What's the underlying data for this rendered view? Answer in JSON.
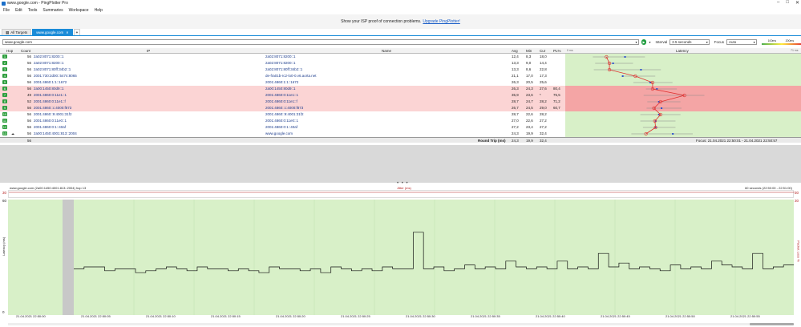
{
  "window": {
    "title": "www.google.com - PingPlotter Pro"
  },
  "menu": [
    "File",
    "Edit",
    "Tools",
    "Summaries",
    "Workspace",
    "Help"
  ],
  "promo": {
    "text": "Show your ISP proof of connection problems.",
    "link": "Upgrade PingPlotter!"
  },
  "tabs": [
    {
      "label": "All Targets"
    },
    {
      "label": "www.google.com"
    },
    {
      "label": "+"
    }
  ],
  "toolbar": {
    "target": "www.google.com",
    "interval_label": "Interval",
    "interval_value": "2.5 seconds",
    "focus_label": "Focus",
    "focus_value": "Auto",
    "legend_low": "100ms",
    "legend_high": "200ms"
  },
  "columns": {
    "hop": "Hop",
    "count": "Count",
    "ip": "IP",
    "name": "Name",
    "avg": "Avg",
    "min": "Min",
    "cur": "Cur",
    "pl": "PL%",
    "lat_zero": "0 ms",
    "latency": "Latency",
    "lat_max": "71 ms"
  },
  "hops": [
    {
      "hop": "1",
      "count": "56",
      "ip": "2a02:8071:8200::1",
      "name": "2a02:8071:8200::1",
      "avg": "12,4",
      "min": "8,3",
      "cur": "18,0",
      "pl": "",
      "loss": false
    },
    {
      "hop": "2",
      "count": "56",
      "ip": "2a02:8071:8200::1",
      "name": "2a02:8071:8200::1",
      "avg": "13,3",
      "min": "9,0",
      "cur": "14,4",
      "pl": "",
      "loss": false
    },
    {
      "hop": "3",
      "count": "56",
      "ip": "2a02:8071:80ff:34b2::1",
      "name": "2a02:8071:80ff:34b2::1",
      "avg": "13,3",
      "min": "8,6",
      "cur": "22,8",
      "pl": "",
      "loss": false
    },
    {
      "hop": "4",
      "count": "56",
      "ip": "2001:730:2d00::5474:8065",
      "name": "de-fra01b-rc2-lo0-0.v6.aorta.net",
      "avg": "21,1",
      "min": "17,0",
      "cur": "17,3",
      "pl": "",
      "loss": false
    },
    {
      "hop": "5",
      "count": "56",
      "ip": "2001:4860:1:1::1672",
      "name": "2001:4860:1:1::1672",
      "avg": "26,3",
      "min": "20,5",
      "cur": "25,6",
      "pl": "",
      "loss": false
    },
    {
      "hop": "6",
      "count": "56",
      "ip": "2a00:1450:80d9::1",
      "name": "2a00:1450:80d9::1",
      "avg": "26,3",
      "min": "24,3",
      "cur": "27,6",
      "pl": "80,4",
      "loss": true
    },
    {
      "hop": "7",
      "count": "49",
      "ip": "2001:4860:0:11e1::1",
      "name": "2001:4860:0:11e1::1",
      "avg": "35,9",
      "min": "23,6",
      "cur": "*",
      "pl": "75,5",
      "loss": true
    },
    {
      "hop": "8",
      "count": "52",
      "ip": "2001:4860:0:11e1::f",
      "name": "2001:4860:0:11e1::f",
      "avg": "28,7",
      "min": "24,7",
      "cur": "28,2",
      "pl": "71,2",
      "loss": true
    },
    {
      "hop": "9",
      "count": "56",
      "ip": "2001:4860::c:4000:f873",
      "name": "2001:4860::c:4000:f873",
      "avg": "26,7",
      "min": "24,5",
      "cur": "29,0",
      "pl": "60,7",
      "loss": true
    },
    {
      "hop": "10",
      "count": "56",
      "ip": "2001:4860::9:4001:31f2",
      "name": "2001:4860::9:4001:31f2",
      "avg": "28,7",
      "min": "22,6",
      "cur": "28,2",
      "pl": "",
      "loss": false
    },
    {
      "hop": "11",
      "count": "56",
      "ip": "2001:4860:0:11e0::1",
      "name": "2001:4860:0:11e0::1",
      "avg": "27,0",
      "min": "22,6",
      "cur": "27,2",
      "pl": "",
      "loss": false
    },
    {
      "hop": "12",
      "count": "56",
      "ip": "2001:4860:0:1::40af",
      "name": "2001:4860:0:1::40af",
      "avg": "27,2",
      "min": "23,4",
      "cur": "27,2",
      "pl": "",
      "loss": false
    },
    {
      "hop": "13",
      "count": "56",
      "ip": "2a00:1450:4001:813::2004",
      "name": "www.google.com",
      "avg": "24,3",
      "min": "19,9",
      "cur": "32,4",
      "pl": "",
      "loss": false
    }
  ],
  "summary": {
    "count": "56",
    "label": "Round Trip (ms)",
    "avg": "24,3",
    "min": "19,9",
    "cur": "32,4",
    "focus": "Focus: 21.04.2021 22:50:01 - 21.04.2021 22:50:57"
  },
  "graph": {
    "title": "www.google.com (2a00:1450:4001:813::2004) hop 13",
    "jitter_label": "Jitter (ms)",
    "range": "60 seconds (22:50:00 - 22:51:00)",
    "jitter_max_left": "30",
    "jitter_max_right": "30",
    "latency_axis": "Latency (ms)",
    "loss_axis": "Packet Loss %",
    "y_max": "60",
    "y_min": "0",
    "loss_max": "30",
    "times": [
      "21.04.2021 22:50:00",
      "21.04.2021 22:50:05",
      "21.04.2021 22:50:10",
      "21.04.2021 22:50:15",
      "21.04.2021 22:50:20",
      "21.04.2021 22:50:25",
      "21.04.2021 22:50:30",
      "21.04.2021 22:50:35",
      "21.04.2021 22:50:40",
      "21.04.2021 22:50:45",
      "21.04.2021 22:50:50",
      "21.04.2021 22:50:55"
    ]
  },
  "chart_data": {
    "type": "line",
    "ylabel": "Latency (ms)",
    "ylim": [
      0,
      60
    ],
    "values": [
      24,
      25,
      25,
      23,
      24,
      24,
      22,
      23,
      24,
      25,
      24,
      23,
      25,
      24,
      24,
      23,
      24,
      23,
      22,
      25,
      24,
      24,
      23,
      24,
      22,
      25,
      24,
      23,
      24,
      23,
      25,
      24,
      24,
      43,
      24,
      25,
      23,
      24,
      26,
      24,
      25,
      24,
      28,
      25,
      24,
      25,
      24,
      28,
      24,
      25,
      24,
      32,
      25,
      27,
      24,
      25,
      24,
      23,
      26,
      24,
      25,
      24,
      28,
      26,
      25,
      24,
      32,
      24,
      25,
      26
    ]
  },
  "latency_points": [
    12.4,
    13.3,
    13.3,
    21.1,
    26.3,
    26.3,
    35.9,
    28.7,
    26.7,
    28.7,
    27.0,
    27.2,
    24.3
  ],
  "latency_min": [
    8.3,
    9.0,
    8.6,
    17.0,
    20.5,
    24.3,
    23.6,
    24.7,
    24.5,
    22.6,
    22.6,
    23.4,
    19.9
  ],
  "latency_cur": [
    18.0,
    14.4,
    22.8,
    17.3,
    25.6,
    27.6,
    0,
    28.2,
    29.0,
    28.2,
    27.2,
    27.2,
    32.4
  ],
  "colors": {
    "accent": "#1b8cd8",
    "ok": "#2e9e3e",
    "plot_bg": "#d8f0c8",
    "loss": "#f4a5a5",
    "line": "#b52020"
  }
}
